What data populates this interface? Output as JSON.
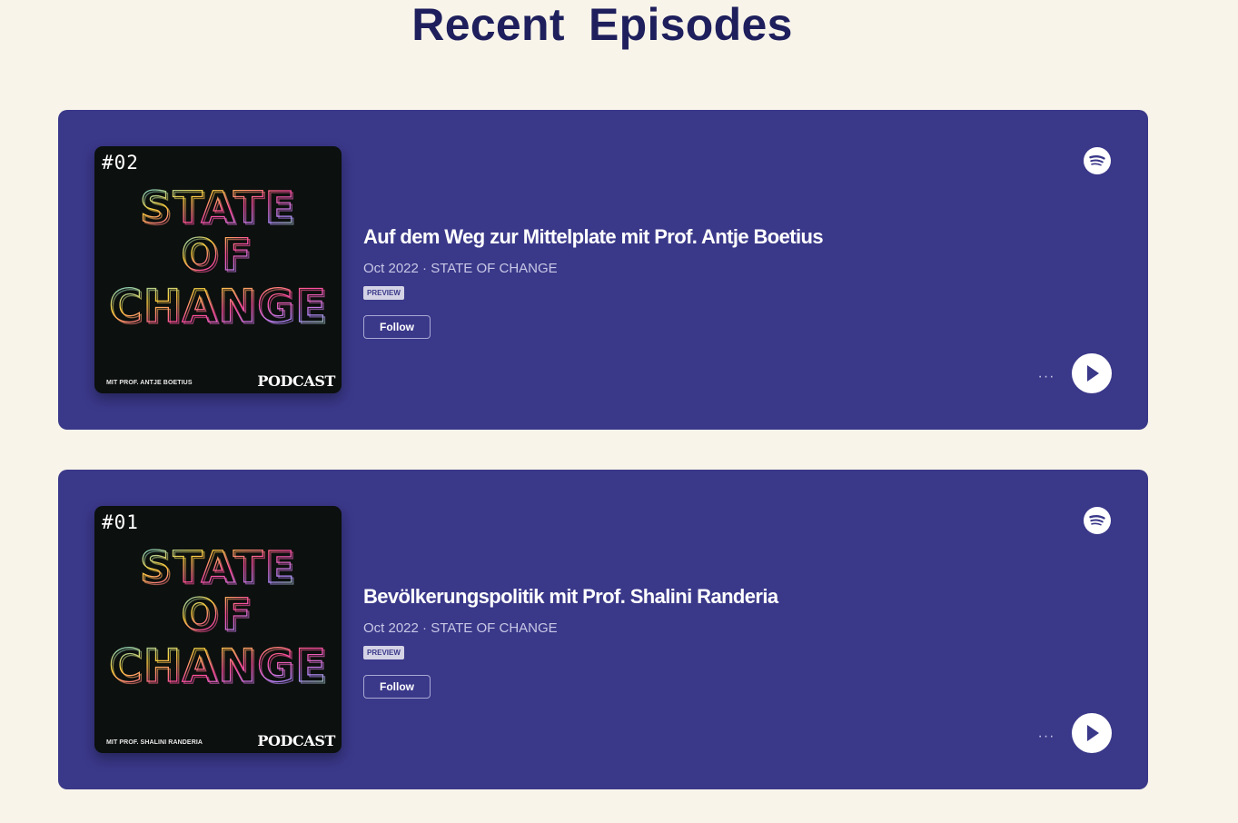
{
  "page": {
    "title": "Recent  Episodes"
  },
  "colors": {
    "background": "#f8f4ea",
    "heading": "#1e1f5c",
    "card": "#3a3889",
    "cover_bg": "#0c100e",
    "iridescent": [
      "#ff4d9d",
      "#ffd23f",
      "#4cc9f0",
      "#7cff6b",
      "#b388ff"
    ]
  },
  "episodes": [
    {
      "cover": {
        "number": "#02",
        "art_lines": [
          "STATE",
          "OF",
          "CHANGE"
        ],
        "host": "MIT PROF. ANTJE BOETIUS",
        "badge": "PODCAST"
      },
      "title": "Auf dem Weg zur Mittelplate mit Prof. Antje Boetius",
      "meta": "Oct 2022 · STATE OF CHANGE",
      "preview_label": "PREVIEW",
      "follow_label": "Follow",
      "more_label": "···",
      "icons": {
        "service": "spotify-icon",
        "play": "play-icon"
      }
    },
    {
      "cover": {
        "number": "#01",
        "art_lines": [
          "STATE",
          "OF",
          "CHANGE"
        ],
        "host": "MIT PROF. SHALINI RANDERIA",
        "badge": "PODCAST"
      },
      "title": "Bevölkerungspolitik mit Prof. Shalini Randeria",
      "meta": "Oct 2022 · STATE OF CHANGE",
      "preview_label": "PREVIEW",
      "follow_label": "Follow",
      "more_label": "···",
      "icons": {
        "service": "spotify-icon",
        "play": "play-icon"
      }
    }
  ]
}
